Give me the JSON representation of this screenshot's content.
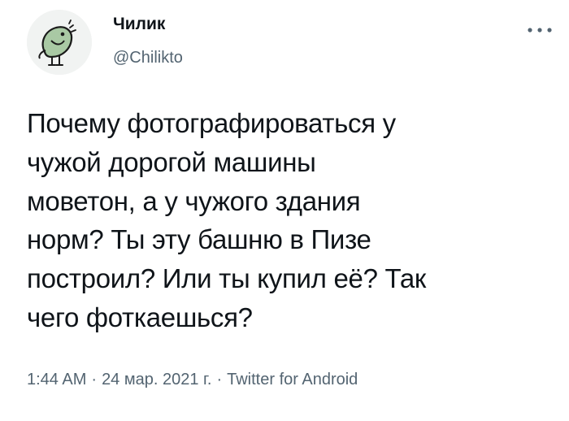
{
  "author": {
    "display_name": "Чилик",
    "handle": "@Chilikto",
    "avatar_icon": "bird-avatar-icon"
  },
  "more_icon": "more-options-icon",
  "tweet": {
    "lines": [
      "Почему фотографироваться у",
      "чужой дорогой машины",
      "моветон, а у чужого здания",
      "норм? Ты эту башню в Пизе",
      "построил? Или ты купил её? Так",
      "чего фоткаешься?"
    ]
  },
  "meta": {
    "time": "1:44 AM",
    "date": "24 мар. 2021 г.",
    "separator": "·",
    "source": "Twitter for Android"
  },
  "colors": {
    "text": "#0f1419",
    "secondary": "#536471",
    "avatar_bird": "#a9c9a4"
  }
}
